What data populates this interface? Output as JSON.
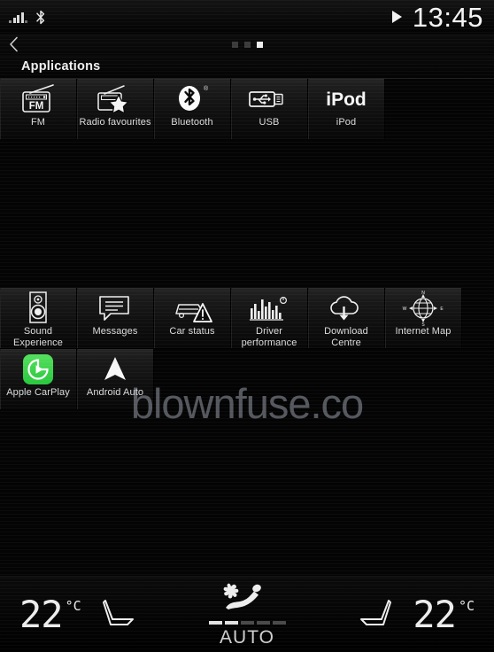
{
  "statusbar": {
    "signal_icon": "signal-bars-icon",
    "bluetooth_icon": "bluetooth-icon",
    "media_play_icon": "play-icon",
    "clock": "13:45"
  },
  "navbar": {
    "back_icon": "back-chevron-icon",
    "page_dots_total": 3,
    "page_dots_active_index": 2
  },
  "header": {
    "title": "Applications"
  },
  "apps": {
    "row1": [
      {
        "label": "FM",
        "icon": "fm-radio-icon"
      },
      {
        "label": "Radio favourites",
        "icon": "radio-favourites-star-icon"
      },
      {
        "label": "Bluetooth",
        "icon": "bluetooth-icon"
      },
      {
        "label": "USB",
        "icon": "usb-stick-icon"
      },
      {
        "label": "iPod",
        "icon": "ipod-wordmark-icon"
      }
    ],
    "row2": [
      {
        "label": "Sound Experience",
        "icon": "speaker-icon"
      },
      {
        "label": "Messages",
        "icon": "message-bubble-icon"
      },
      {
        "label": "Car status",
        "icon": "car-warning-triangle-icon"
      },
      {
        "label": "Driver performance",
        "icon": "bar-chart-icon"
      },
      {
        "label": "Download Centre",
        "icon": "cloud-download-icon"
      },
      {
        "label": "Internet Map",
        "icon": "globe-compass-icon"
      }
    ],
    "row3": [
      {
        "label": "Apple CarPlay",
        "icon": "apple-carplay-icon"
      },
      {
        "label": "Android Auto",
        "icon": "android-auto-icon"
      }
    ]
  },
  "watermark": {
    "text": "blownfuse.co"
  },
  "climate": {
    "left_temperature_value": "22",
    "left_temperature_unit": "°C",
    "right_temperature_value": "22",
    "right_temperature_unit": "°C",
    "left_seat_icon": "seat-icon",
    "right_seat_icon": "seat-icon",
    "airflow_icon": "fan-seat-airflow-icon",
    "auto_label": "AUTO",
    "fan_level_segments": 5,
    "fan_level_active": 2
  },
  "colors": {
    "background": "#040404",
    "tile_top": "#242424",
    "text": "#e8e8e8",
    "carplay_green": "#3ad24a",
    "watermark": "#c4cad8"
  }
}
